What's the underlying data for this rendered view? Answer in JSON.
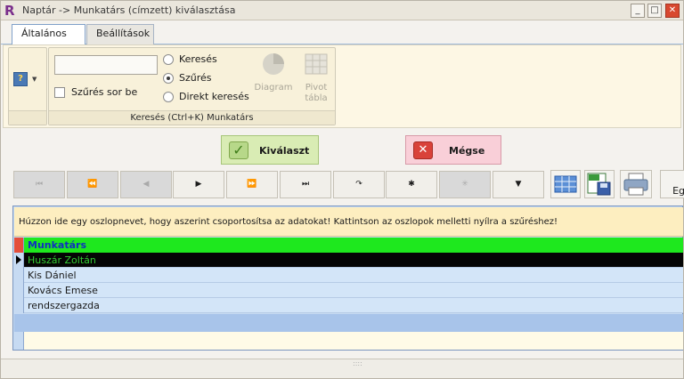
{
  "window": {
    "title": "Naptár -> Munkatárs (címzett) kiválasztása",
    "app_icon_letter": "R",
    "minimize": "_",
    "maximize": "□",
    "close": "✕"
  },
  "tabs": [
    {
      "label": "Általános",
      "active": true
    },
    {
      "label": "Beállítások",
      "active": false
    }
  ],
  "ribbon": {
    "help_icon": "?",
    "search_value": "",
    "filter_row_label": "Szűrés sor be",
    "filter_row_checked": false,
    "radios": [
      {
        "label": "Keresés",
        "checked": false
      },
      {
        "label": "Szűrés",
        "checked": true
      },
      {
        "label": "Direkt keresés",
        "checked": false
      }
    ],
    "diagram_label": "Diagram",
    "pivot_label_1": "Pivot",
    "pivot_label_2": "tábla",
    "group_caption": "Keresés (Ctrl+K) Munkatárs"
  },
  "actions": {
    "ok_label": "Kiválaszt",
    "cancel_label": "Mégse"
  },
  "nav": {
    "buttons": [
      {
        "glyph": "⏮",
        "disabled": true
      },
      {
        "glyph": "⏪",
        "disabled": true
      },
      {
        "glyph": "◀",
        "disabled": true
      },
      {
        "glyph": "▶",
        "disabled": false
      },
      {
        "glyph": "⏩",
        "disabled": false
      },
      {
        "glyph": "⏭",
        "disabled": false
      },
      {
        "glyph": "↷",
        "disabled": false
      },
      {
        "glyph": "✱",
        "disabled": false
      },
      {
        "glyph": "✳",
        "disabled": true
      },
      {
        "glyph": "▼",
        "disabled": false
      }
    ],
    "edge_label": "Eg"
  },
  "grid": {
    "group_hint": "Húzzon ide egy oszlopnevet, hogy aszerint csoportosítsa az adatokat! Kattintson az oszlopok melletti nyílra a szűréshez!",
    "column_header": "Munkatárs",
    "rows": [
      {
        "value": "Huszár Zoltán",
        "selected": true
      },
      {
        "value": "Kis Dániel",
        "selected": false
      },
      {
        "value": "Kovács Emese",
        "selected": false
      },
      {
        "value": "rendszergazda",
        "selected": false
      }
    ]
  },
  "colors": {
    "header_green": "#1ee81e",
    "selected_row": "#050505",
    "selected_text": "#33cc33",
    "row_bg": "#d3e5f8",
    "ok_bg": "#d9ecb4",
    "cancel_bg": "#f9cfd8"
  }
}
